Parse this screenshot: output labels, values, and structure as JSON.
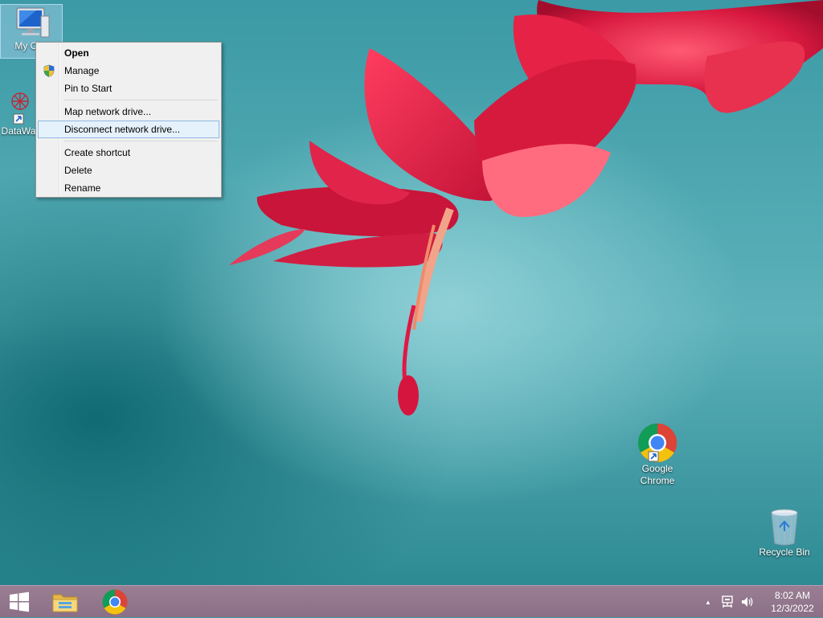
{
  "desktop": {
    "icons": [
      {
        "label": "My Computer",
        "visible_label": "My Con",
        "icon": "computer-icon"
      },
      {
        "label": "DataWa",
        "visible_label": "DataWa",
        "icon": "datawarehouse-icon"
      },
      {
        "label": "Google Chrome",
        "label_line1": "Google",
        "label_line2": "Chrome",
        "icon": "chrome-icon"
      },
      {
        "label": "Recycle Bin",
        "icon": "recycle-bin-icon"
      }
    ]
  },
  "context_menu": {
    "items": [
      {
        "label": "Open",
        "bold": true
      },
      {
        "label": "Manage",
        "icon": "uac-shield-icon"
      },
      {
        "label": "Pin to Start"
      },
      {
        "label": "Map network drive..."
      },
      {
        "label": "Disconnect network drive...",
        "highlighted": true
      },
      {
        "label": "Create shortcut"
      },
      {
        "label": "Delete"
      },
      {
        "label": "Rename"
      }
    ]
  },
  "taskbar": {
    "start": "windows-logo-icon",
    "pinned": [
      "file-explorer-icon",
      "chrome-icon"
    ],
    "tray": {
      "show_hidden": "▲",
      "network": "network-icon",
      "volume": "volume-icon",
      "time": "8:02 AM",
      "date": "12/3/2022"
    }
  },
  "colors": {
    "menu_highlight": "#e5f1fb",
    "menu_highlight_border": "#8fb9e4",
    "taskbar": "#8a6f86"
  }
}
